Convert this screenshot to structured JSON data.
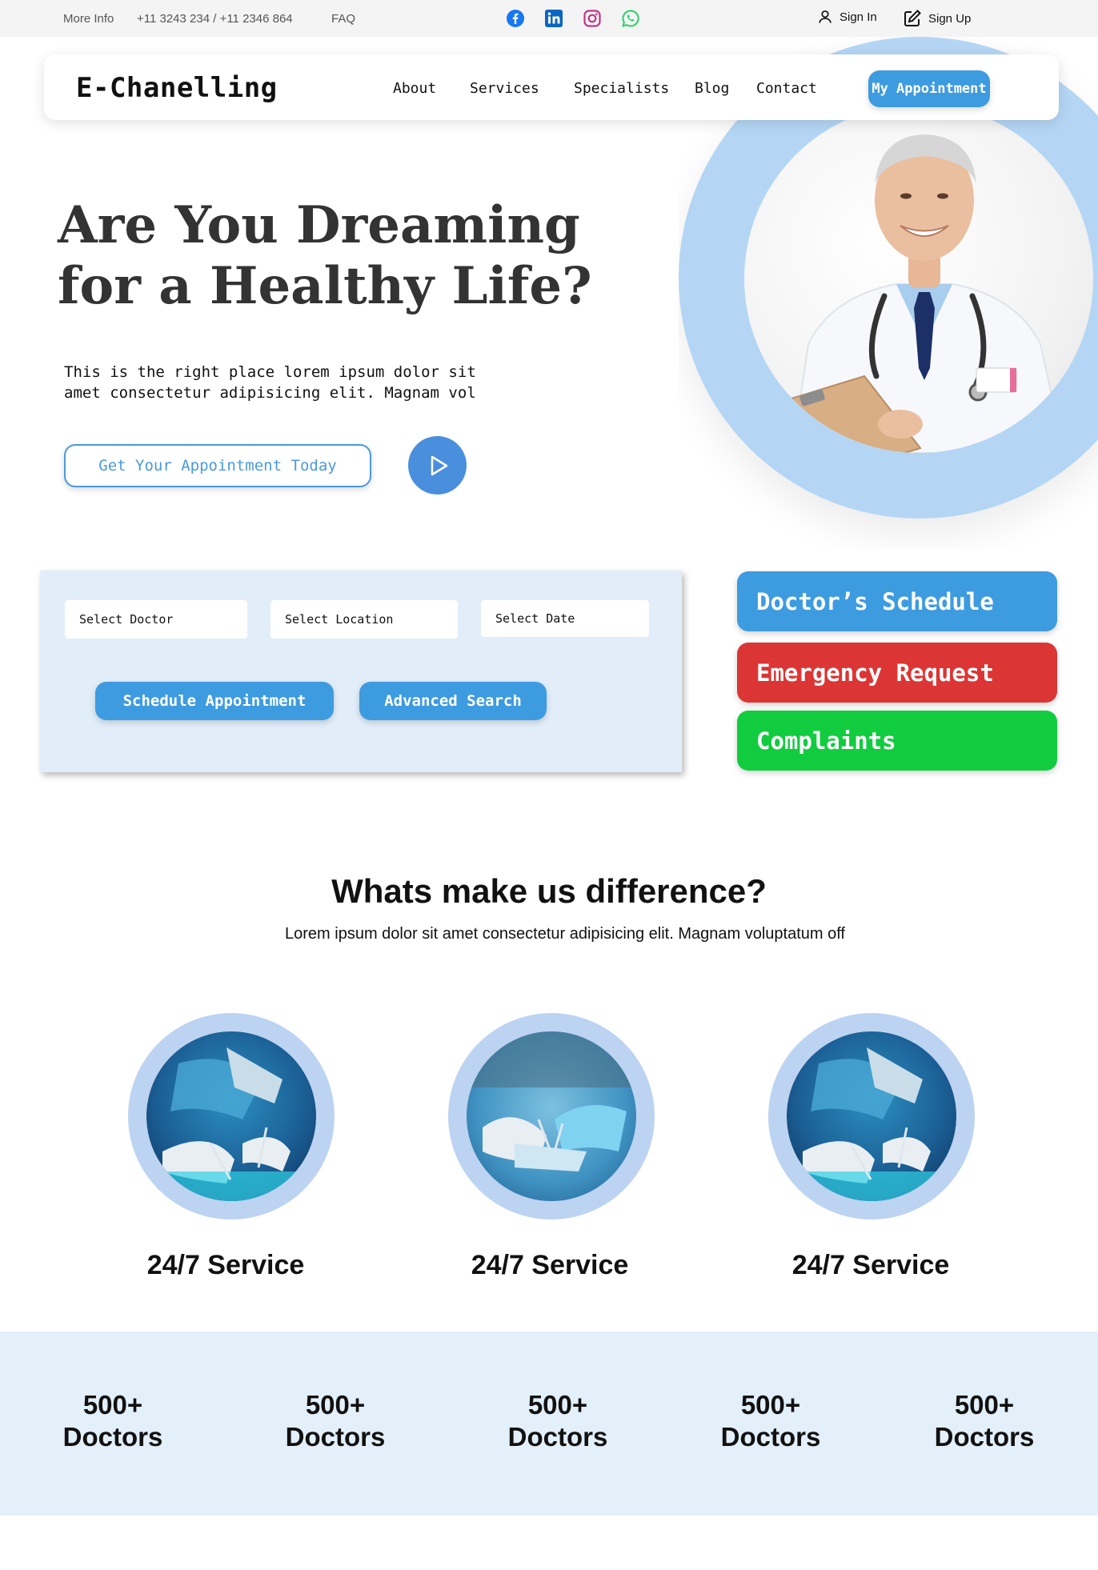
{
  "topbar": {
    "more_info": "More Info",
    "phones": "+11 3243 234 / +11 2346 864",
    "faq": "FAQ",
    "social": [
      {
        "icon": "facebook-icon",
        "color": "#1877F2"
      },
      {
        "icon": "linkedin-icon",
        "color": "#0A66C2"
      },
      {
        "icon": "instagram-icon",
        "color": "#C13584"
      },
      {
        "icon": "whatsapp-icon",
        "color": "#25D366"
      }
    ],
    "sign_in": "Sign In",
    "sign_up": "Sign Up"
  },
  "nav": {
    "logo": "E-Chanelling",
    "links": [
      "About",
      "Services",
      "Specialists",
      "Blog",
      "Contact"
    ],
    "cta": "My Appointment"
  },
  "hero": {
    "title": "Are You Dreaming for a Healthy Life?",
    "text": "This is the right place lorem ipsum dolor sit amet consectetur adipisicing elit. Magnam vol",
    "cta": "Get Your Appointment Today",
    "play_icon": "play-icon"
  },
  "search": {
    "doctor": "Select Doctor",
    "location": "Select Location",
    "date": "Select Date",
    "schedule": "Schedule Appointment",
    "advanced": "Advanced Search"
  },
  "actions": [
    {
      "label": "Doctor’s Schedule",
      "color": "#3d9be0"
    },
    {
      "label": "Emergency Request",
      "color": "#dc3535"
    },
    {
      "label": "Complaints",
      "color": "#12cc3f"
    }
  ],
  "difference": {
    "title": "Whats make us difference?",
    "subtitle": "Lorem ipsum dolor sit amet consectetur adipisicing elit. Magnam voluptatum off",
    "features": [
      "24/7 Service",
      "24/7 Service",
      "24/7 Service"
    ]
  },
  "stats": [
    {
      "value": "500+",
      "label": "Doctors"
    },
    {
      "value": "500+",
      "label": "Doctors"
    },
    {
      "value": "500+",
      "label": "Doctors"
    },
    {
      "value": "500+",
      "label": "Doctors"
    },
    {
      "value": "500+",
      "label": "Doctors"
    }
  ],
  "colors": {
    "accent": "#3d9be0",
    "emergency": "#dc3535",
    "complaints": "#12cc3f",
    "panel_bg": "#e1eef9",
    "ring": "#b4d6f4"
  }
}
